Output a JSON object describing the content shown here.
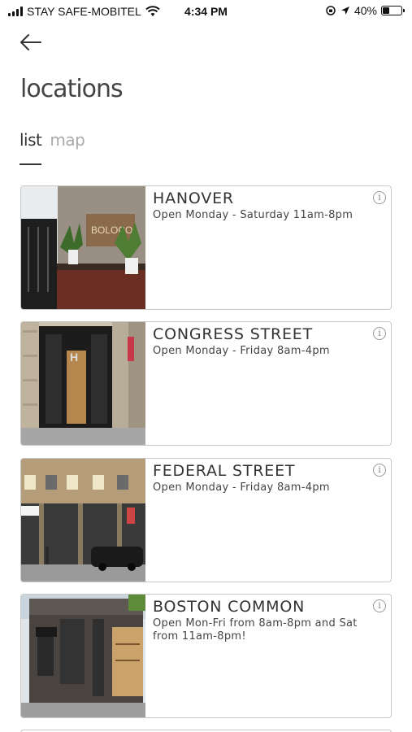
{
  "status_bar": {
    "carrier": "STAY SAFE-MOBITEL",
    "time": "4:34 PM",
    "battery": "40%",
    "battery_level": 0.4,
    "icons": [
      "signal-icon",
      "wifi-icon",
      "orientation-lock-icon",
      "location-arrow-icon",
      "battery-icon"
    ]
  },
  "header": {
    "back_icon": "arrow-left-icon",
    "title": "locations"
  },
  "tabs": [
    {
      "label": "list",
      "active": true
    },
    {
      "label": "map",
      "active": false
    }
  ],
  "locations": [
    {
      "name": "HANOVER",
      "hours": "Open Monday - Saturday 11am-8pm",
      "info_icon": "info-icon"
    },
    {
      "name": "CONGRESS STREET",
      "hours": "Open Monday - Friday 8am-4pm",
      "info_icon": "info-icon"
    },
    {
      "name": "FEDERAL STREET",
      "hours": "Open Monday - Friday 8am-4pm",
      "info_icon": "info-icon"
    },
    {
      "name": "BOSTON COMMON",
      "hours": "Open Mon-Fri from 8am-8pm and Sat from 11am-8pm!",
      "info_icon": "info-icon"
    }
  ],
  "storefront_sign_text": "BOLOCO",
  "colors": {
    "text_dark": "#333333",
    "tab_inactive": "#aaaaaa",
    "card_border": "#c8c8c8"
  }
}
